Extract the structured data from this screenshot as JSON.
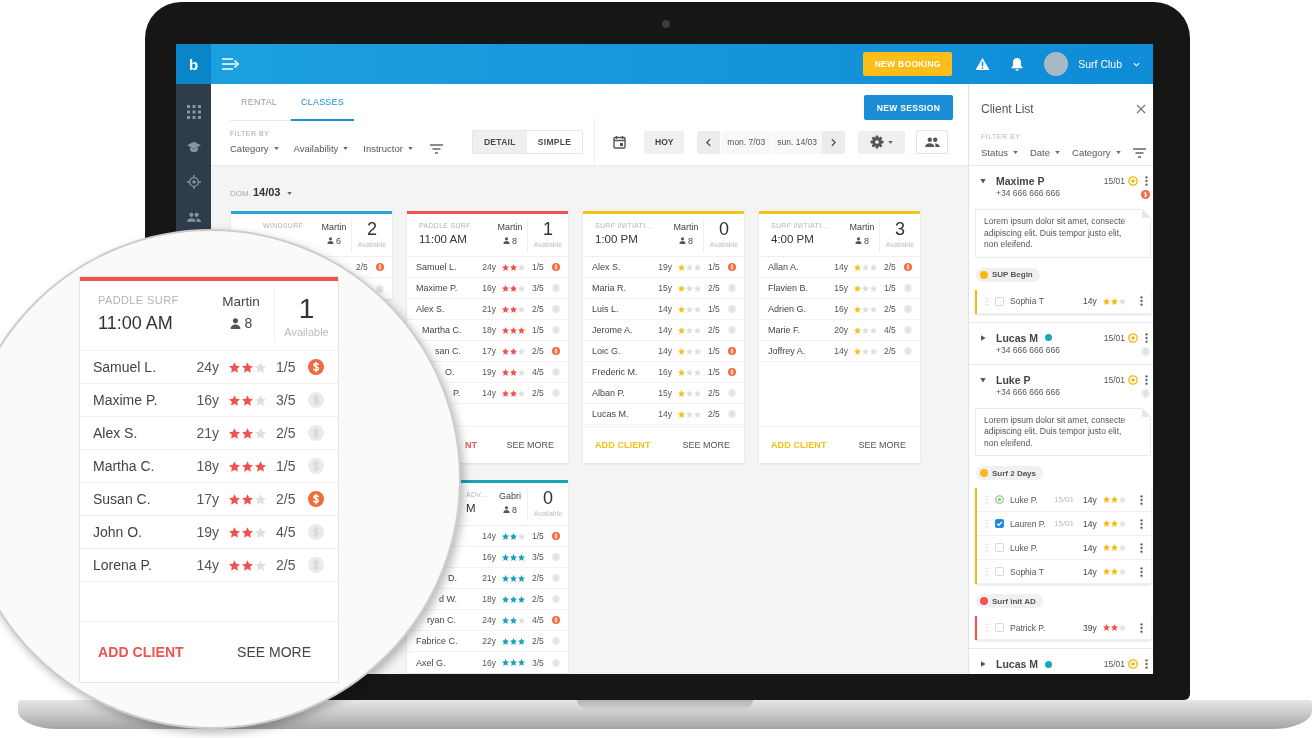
{
  "app": {
    "logo": "b"
  },
  "top_bar": {
    "new_booking": "NEW BOOKING",
    "account": "Surf Club"
  },
  "tabs": [
    {
      "label": "RENTAL",
      "selected": false
    },
    {
      "label": "CLASSES",
      "selected": true
    }
  ],
  "new_session": "NEW SESSION",
  "filters": {
    "label": "FILTER BY",
    "dropdowns": [
      "Category",
      "Availability",
      "Instructor"
    ]
  },
  "view_modes": [
    {
      "label": "DETAIL",
      "selected": true
    },
    {
      "label": "SIMPLE",
      "selected": false
    }
  ],
  "today": "HOY",
  "date_range": {
    "start": "mon. 7/03",
    "end": "sun. 14/03"
  },
  "day": {
    "weekday": "DOM.",
    "date": "14/03"
  },
  "class_columns": [
    {
      "cards": [
        {
          "category": "WINDSURF",
          "instructor": "Martin",
          "capacity": "6",
          "available_count": "2",
          "available_label": "Available",
          "color": "#2aa4dc",
          "students": [
            {
              "sessions": "2/5",
              "paid": true
            },
            {
              "paid": false
            }
          ]
        }
      ]
    },
    {
      "cards": [
        {
          "category": "PADDLE SURF",
          "time": "11:00 AM",
          "instructor": "Martin",
          "capacity": "8",
          "available_count": "1",
          "available_label": "Available",
          "color": "#ef5350",
          "students": [
            {
              "name": "Samuel L.",
              "age": "24y",
              "stars": 2,
              "sessions": "1/5",
              "paid": true
            },
            {
              "name": "Maxime P.",
              "age": "16y",
              "stars": 2,
              "sessions": "3/5",
              "paid": false
            },
            {
              "name": "Alex S.",
              "age": "21y",
              "stars": 2,
              "sessions": "2/5",
              "paid": false
            },
            {
              "name": "Martha C.",
              "age": "18y",
              "stars": 3,
              "sessions": "1/5",
              "paid": false
            },
            {
              "name": "san C.",
              "age": "17y",
              "stars": 2,
              "sessions": "2/5",
              "paid": true
            },
            {
              "name": "O.",
              "age": "19y",
              "stars": 2,
              "sessions": "4/5",
              "paid": false
            },
            {
              "name": "P.",
              "age": "14y",
              "stars": 2,
              "sessions": "2/5",
              "paid": false
            }
          ],
          "add_client": "NT",
          "see_more": "SEE MORE"
        },
        {
          "category": "ADV...",
          "time": "M",
          "instructor": "Gabri",
          "capacity": "8",
          "available_count": "0",
          "available_label": "Available",
          "color": "#19a3b7",
          "students": [
            {
              "age": "14y",
              "stars": 2,
              "sessions": "1/5",
              "paid": true
            },
            {
              "age": "16y",
              "stars": 3,
              "sessions": "3/5",
              "paid": false
            },
            {
              "name": "D.",
              "age": "21y",
              "stars": 3,
              "sessions": "2/5",
              "paid": false
            },
            {
              "name": "d W.",
              "age": "18y",
              "stars": 3,
              "sessions": "2/5",
              "paid": false
            },
            {
              "name": "ryan C.",
              "age": "24y",
              "stars": 2,
              "sessions": "4/5",
              "paid": true
            },
            {
              "name": "Fabrice C.",
              "age": "22y",
              "stars": 3,
              "sessions": "2/5",
              "paid": false
            },
            {
              "name": "Axel G.",
              "age": "16y",
              "stars": 3,
              "sessions": "3/5",
              "paid": false
            }
          ]
        }
      ]
    },
    {
      "cards": [
        {
          "category": "SURF INITIATI...",
          "time": "1:00 PM",
          "instructor": "Martin",
          "capacity": "8",
          "available_count": "0",
          "available_label": "Available",
          "color": "#f5c21b",
          "students": [
            {
              "name": "Alex S.",
              "age": "19y",
              "stars": 1,
              "sessions": "1/5",
              "paid": true
            },
            {
              "name": "Maria R.",
              "age": "15y",
              "stars": 1,
              "sessions": "2/5",
              "paid": false
            },
            {
              "name": "Luis L.",
              "age": "14y",
              "stars": 1,
              "sessions": "1/5",
              "paid": false
            },
            {
              "name": "Jerome A.",
              "age": "14y",
              "stars": 1,
              "sessions": "2/5",
              "paid": false
            },
            {
              "name": "Loic G.",
              "age": "14y",
              "stars": 1,
              "sessions": "1/5",
              "paid": true
            },
            {
              "name": "Frederic M.",
              "age": "16y",
              "stars": 1,
              "sessions": "1/5",
              "paid": true
            },
            {
              "name": "Alban P.",
              "age": "15y",
              "stars": 1,
              "sessions": "2/5",
              "paid": false
            },
            {
              "name": "Lucas M.",
              "age": "14y",
              "stars": 1,
              "sessions": "2/5",
              "paid": false
            }
          ],
          "add_client": "ADD CLIENT",
          "see_more": "SEE MORE"
        }
      ]
    },
    {
      "cards": [
        {
          "category": "SURF INITIATI...",
          "time": "4:00 PM",
          "instructor": "Martin",
          "capacity": "8",
          "available_count": "3",
          "available_label": "Available",
          "color": "#f5c21b",
          "students": [
            {
              "name": "Allan A.",
              "age": "14y",
              "stars": 1,
              "sessions": "2/5",
              "paid": true
            },
            {
              "name": "Flavien B.",
              "age": "15y",
              "stars": 1,
              "sessions": "1/5",
              "paid": false
            },
            {
              "name": "Adrien G.",
              "age": "16y",
              "stars": 1,
              "sessions": "2/5",
              "paid": false
            },
            {
              "name": "Marie F.",
              "age": "20y",
              "stars": 1,
              "sessions": "4/5",
              "paid": false
            },
            {
              "name": "Joffrey A.",
              "age": "14y",
              "stars": 1,
              "sessions": "2/5",
              "paid": false
            }
          ],
          "add_client": "ADD CLIENT",
          "see_more": "SEE MORE"
        }
      ]
    }
  ],
  "magnifier": {
    "card": {
      "category": "PADDLE SURF",
      "time": "11:00 AM",
      "instructor": "Martin",
      "capacity": "8",
      "available_count": "1",
      "available_label": "Available",
      "color": "#ef5350",
      "students": [
        {
          "name": "Samuel L.",
          "age": "24y",
          "stars": 2,
          "sessions": "1/5",
          "paid": true
        },
        {
          "name": "Maxime P.",
          "age": "16y",
          "stars": 2,
          "sessions": "3/5",
          "paid": false
        },
        {
          "name": "Alex S.",
          "age": "21y",
          "stars": 2,
          "sessions": "2/5",
          "paid": false
        },
        {
          "name": "Martha C.",
          "age": "18y",
          "stars": 3,
          "sessions": "1/5",
          "paid": false
        },
        {
          "name": "Susan C.",
          "age": "17y",
          "stars": 2,
          "sessions": "2/5",
          "paid": true
        },
        {
          "name": "John O.",
          "age": "19y",
          "stars": 2,
          "sessions": "4/5",
          "paid": false
        },
        {
          "name": "Lorena P.",
          "age": "14y",
          "stars": 2,
          "sessions": "2/5",
          "paid": false
        }
      ],
      "add_client": "ADD CLIENT",
      "see_more": "SEE MORE"
    }
  },
  "client_list": {
    "title": "Client List",
    "filter_label": "FILTER BY",
    "filters": [
      "Status",
      "Date",
      "Category"
    ],
    "clients": [
      {
        "name": "Maxime P",
        "phone": "+34 666 666 666",
        "date": "15/01",
        "expanded": true,
        "paid": true,
        "note": "Lorem ipsum dolor sit amet, consecte adipiscing elit. Duis tempor justo elit, non eleifend.",
        "groups": [
          {
            "name": "SUP Begin",
            "color": "#f6b914",
            "students": [
              {
                "kind": "checkbox",
                "checked": false,
                "name": "Sophia T",
                "age": "14y",
                "stars": 2
              }
            ]
          }
        ]
      },
      {
        "name": "Lucas M",
        "color": "#17a7b8",
        "phone": "+34 666 666 666",
        "date": "15/01",
        "expanded": false,
        "paid": false
      },
      {
        "name": "Luke P",
        "phone": "+34 666 666 666",
        "date": "15/01",
        "expanded": true,
        "paid": false,
        "note": "Lorem ipsum dolor sit amet, consecte adipiscing elit. Duis tempor justo elit, non eleifend.",
        "groups": [
          {
            "name": "Surf 2 Days",
            "color": "#f6b914",
            "students": [
              {
                "kind": "status",
                "name": "Luke P.",
                "date": "15/01",
                "age": "14y",
                "stars": 2
              },
              {
                "kind": "checkbox",
                "checked": true,
                "name": "Lauren P.",
                "date": "15/01",
                "age": "14y",
                "stars": 2
              },
              {
                "kind": "checkbox",
                "checked": false,
                "name": "Luke P.",
                "age": "14y",
                "stars": 2
              },
              {
                "kind": "checkbox",
                "checked": false,
                "name": "Sophia T",
                "age": "14y",
                "stars": 2
              }
            ]
          },
          {
            "name": "Surf init AD",
            "color": "#ef5350",
            "students": [
              {
                "kind": "checkbox",
                "checked": false,
                "name": "Patrick P.",
                "age": "39y",
                "stars": 2
              }
            ]
          }
        ]
      },
      {
        "name": "Lucas M",
        "color": "#17a7b8",
        "date": "15/01",
        "expanded": false
      }
    ]
  }
}
